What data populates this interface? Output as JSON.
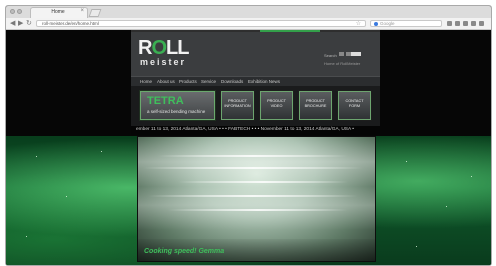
{
  "browser": {
    "tab_title": "Home",
    "tab_close": "×",
    "back": "◀",
    "forward": "▶",
    "reload": "↻",
    "url": "roll-meister.de/en/home.html",
    "star": "☆",
    "search_placeholder": "Google"
  },
  "header": {
    "logo_roll_r": "R",
    "logo_roll_o": "O",
    "logo_roll_rest": "LL",
    "logo_meister": "meister",
    "util_search": "Search",
    "util_link": "Home of RollMeister"
  },
  "nav": {
    "items": [
      "Home",
      "About us",
      "Products",
      "Service",
      "Downloads",
      "Exhibition News"
    ]
  },
  "product": {
    "title": "TETRA",
    "subtitle": "a self-sized bending machine"
  },
  "features": [
    {
      "label": "PRODUCT INFORMATION"
    },
    {
      "label": "PRODUCT VIDEO"
    },
    {
      "label": "PRODUCT BROCHURE"
    },
    {
      "label": "CONTACT FORM"
    }
  ],
  "ticker": {
    "text": "ember 11 to 13, 2014 Atlanta/GA, USA • • •     FABTECH • • • November 11 to 13, 2014 Atlanta/GA, USA •"
  },
  "hero": {
    "caption": "Cooking speed! Gemma"
  },
  "colors": {
    "brand_green": "#3fbf5c",
    "header_gray": "#3b3d3f"
  }
}
